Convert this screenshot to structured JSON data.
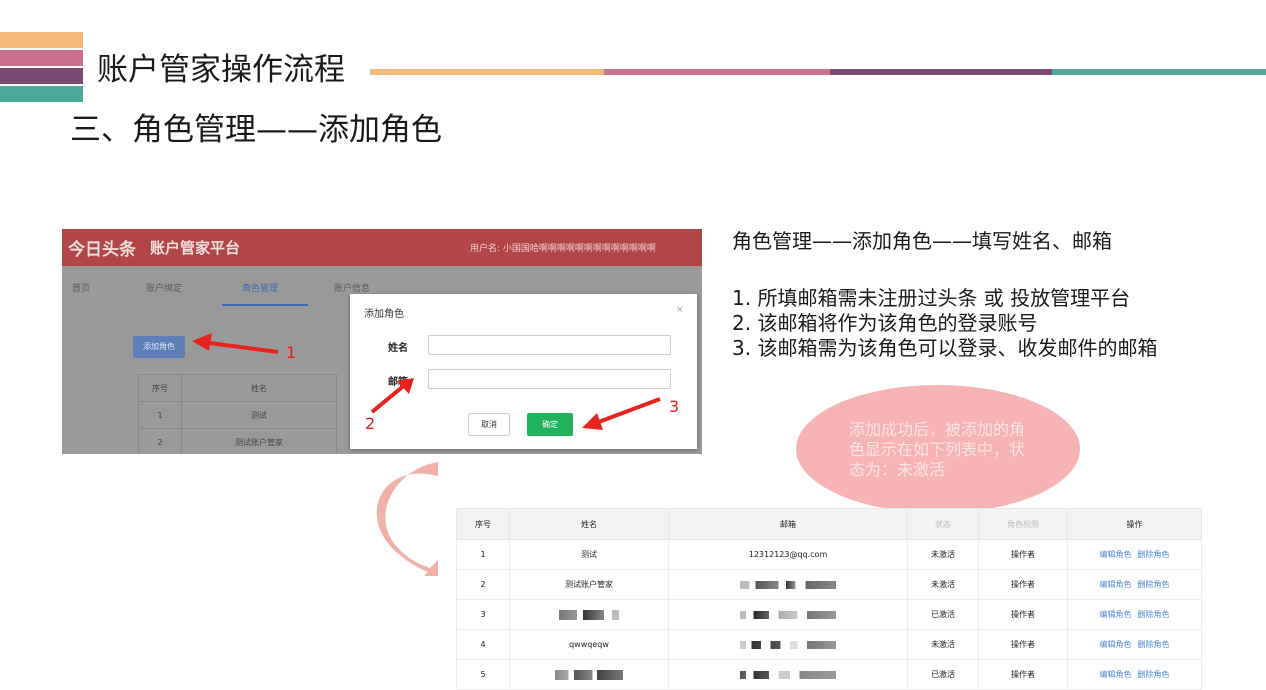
{
  "slide": {
    "title": "账户管家操作流程",
    "section": "三、角色管理——添加角色",
    "colors": {
      "orange": "#f2b978",
      "pink": "#c9728d",
      "purple": "#7a4a73",
      "teal": "#4fa99a"
    }
  },
  "screenshot": {
    "logo": "今日头条",
    "platform": "账户管家平台",
    "user": "用户名: 小国国哈啊啊啊啊啊啊啊啊啊啊啊啊啊",
    "nav": [
      "首页",
      "账户绑定",
      "角色管理",
      "账户信息"
    ],
    "add_button": "添加角色",
    "table": {
      "headers": [
        "序号",
        "姓名"
      ],
      "rows": [
        [
          "1",
          "测试"
        ],
        [
          "2",
          "测试账户管家"
        ]
      ]
    }
  },
  "modal": {
    "title": "添加角色",
    "close": "×",
    "name_label": "姓名",
    "email_label": "邮箱",
    "cancel": "取消",
    "confirm": "确定"
  },
  "annotations": {
    "n1": "1",
    "n2": "2",
    "n3": "3"
  },
  "instructions": {
    "heading": "角色管理——添加角色——填写姓名、邮箱",
    "items": [
      "1.  所填邮箱需未注册过头条 或 投放管理平台",
      "2.  该邮箱将作为该角色的登录账号",
      "3.  该邮箱需为该角色可以登录、收发邮件的邮箱"
    ]
  },
  "bubble": "添加成功后，被添加的角色显示在如下列表中，状态为：未激活",
  "result_table": {
    "headers": [
      "序号",
      "姓名",
      "邮箱",
      "状态",
      "角色权限",
      "操作"
    ],
    "rows": [
      {
        "no": "1",
        "name": "测试",
        "email": "12312123@qq.com",
        "status": "未激活",
        "role": "操作者"
      },
      {
        "no": "2",
        "name": "测试账户管家",
        "email": "",
        "status": "未激活",
        "role": "操作者"
      },
      {
        "no": "3",
        "name": "",
        "email": "",
        "status": "已激活",
        "role": "操作者"
      },
      {
        "no": "4",
        "name": "qwwqeqw",
        "email": "",
        "status": "未激活",
        "role": "操作者"
      },
      {
        "no": "5",
        "name": "",
        "email": "",
        "status": "已激活",
        "role": "操作者"
      }
    ],
    "edit": "编辑角色",
    "delete": "删除角色"
  }
}
